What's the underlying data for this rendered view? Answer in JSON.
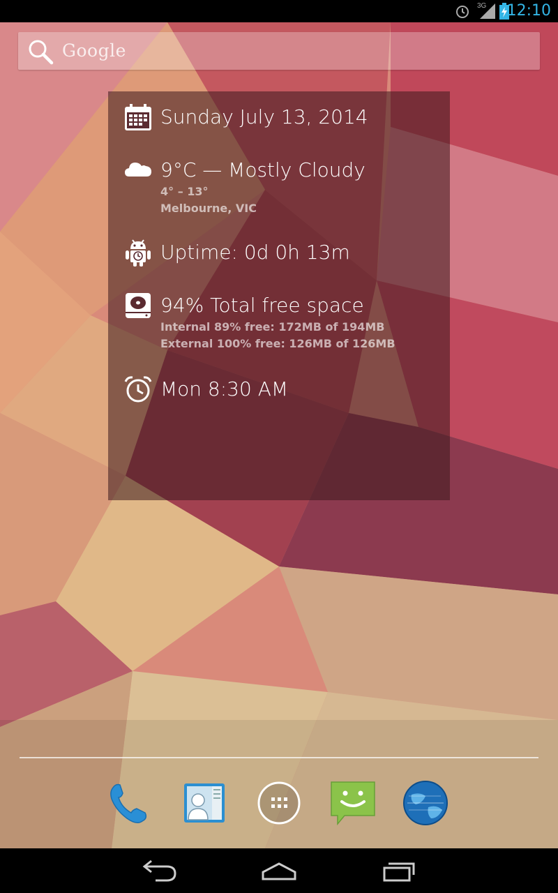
{
  "status_bar": {
    "time": "12:10",
    "network": "3G",
    "icons": [
      "alarm-icon",
      "signal-icon",
      "battery-charging-icon"
    ]
  },
  "search": {
    "label": "Google"
  },
  "widget": {
    "date": "Sunday July 13, 2014",
    "weather": {
      "main": "9°C — Mostly Cloudy",
      "range": "4° – 13°",
      "location": "Melbourne, VIC"
    },
    "uptime": "Uptime: 0d 0h 13m",
    "storage": {
      "main": "94% Total free space",
      "internal": "Internal 89% free: 172MB of 194MB",
      "external": "External 100% free: 126MB of 126MB"
    },
    "alarm": "Mon 8:30 AM"
  },
  "dock": {
    "items": [
      "phone-icon",
      "contacts-icon",
      "app-drawer-icon",
      "messaging-icon",
      "browser-icon"
    ]
  },
  "nav": {
    "buttons": [
      "back-icon",
      "home-icon",
      "recents-icon"
    ]
  },
  "colors": {
    "accent": "#33b5e5",
    "widget_bg": "#3c191e"
  }
}
